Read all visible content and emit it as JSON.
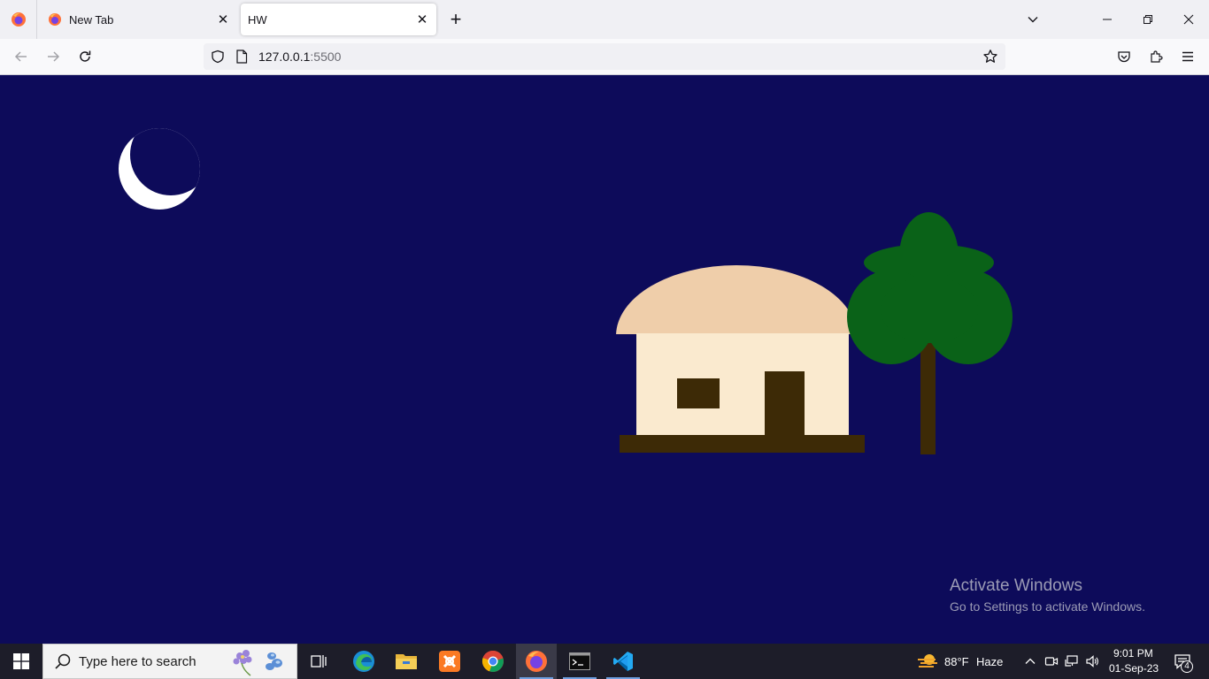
{
  "browser": {
    "tabs": [
      {
        "title": "New Tab",
        "active": false
      },
      {
        "title": "HW",
        "active": true
      }
    ],
    "url": {
      "host": "127.0.0.1",
      "port": ":5500"
    }
  },
  "scene": {
    "colors": {
      "sky": "#0d0b5a",
      "moon": "#ffffff",
      "roof": "#efceaa",
      "wall": "#faeacf",
      "wood": "#3d2a06",
      "leaves": "#0a6218"
    }
  },
  "watermark": {
    "line1": "Activate Windows",
    "line2": "Go to Settings to activate Windows."
  },
  "taskbar": {
    "search_placeholder": "Type here to search",
    "apps": [
      "task-view",
      "edge",
      "file-explorer",
      "xampp",
      "chrome",
      "firefox",
      "terminal",
      "vscode"
    ],
    "weather": {
      "temp": "88°F",
      "condition": "Haze"
    },
    "clock": {
      "time": "9:01 PM",
      "date": "01-Sep-23"
    },
    "notifications": "4"
  }
}
